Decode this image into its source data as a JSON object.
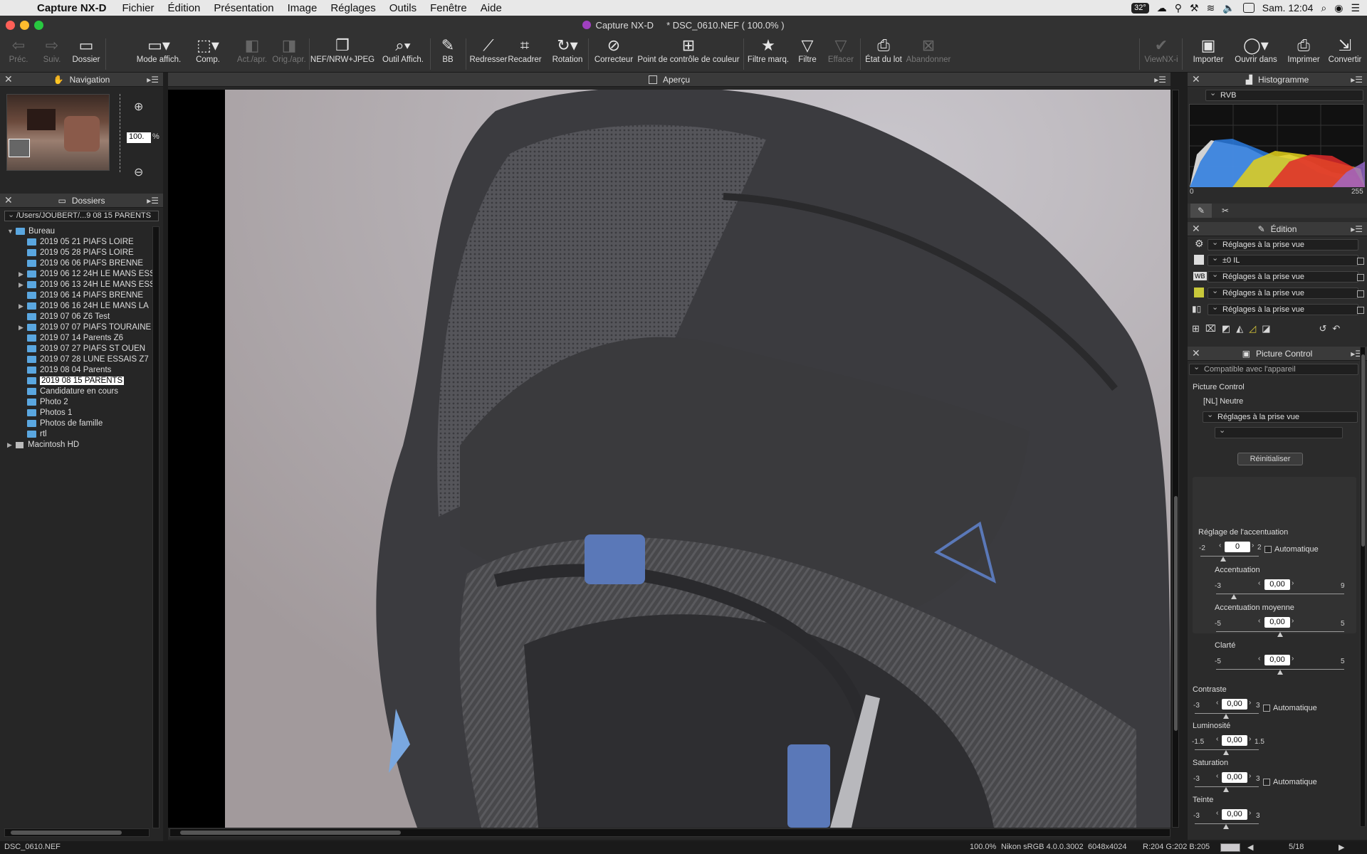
{
  "menubar": {
    "app": "Capture NX-D",
    "items": [
      "Fichier",
      "Édition",
      "Présentation",
      "Image",
      "Réglages",
      "Outils",
      "Fenêtre",
      "Aide"
    ],
    "temp": "32°",
    "clock": "Sam. 12:04"
  },
  "window": {
    "app_title": "Capture NX-D",
    "doc_title": "* DSC_0610.NEF ( 100.0% )"
  },
  "toolbar": {
    "prec": "Préc.",
    "suiv": "Suiv.",
    "dossier": "Dossier",
    "mode_affich": "Mode affich.",
    "comp": "Comp.",
    "act_apr": "Act./apr.",
    "orig_apr": "Orig./apr.",
    "nef": "NEF/NRW+JPEG",
    "outil_affich": "Outil Affich.",
    "bb": "BB",
    "redresser": "Redresser",
    "recadrer": "Recadrer",
    "rotation": "Rotation",
    "correcteur": "Correcteur",
    "point_controle": "Point de contrôle de couleur",
    "filtre_marq": "Filtre marq.",
    "filtre": "Filtre",
    "effacer": "Effacer",
    "etat_lot": "État du lot",
    "abandonner": "Abandonner",
    "viewnx": "ViewNX-i",
    "importer": "Importer",
    "ouvrir_dans": "Ouvrir dans",
    "imprimer": "Imprimer",
    "convertir": "Convertir"
  },
  "navigation": {
    "title": "Navigation",
    "zoom_value": "100.",
    "zoom_unit": "%"
  },
  "folders": {
    "title": "Dossiers",
    "path": "/Users/JOUBERT/...9 08 15 PARENTS",
    "root": "Bureau",
    "items": [
      "2019 05 21 PIAFS LOIRE",
      "2019 05 28 PIAFS LOIRE",
      "2019 06 06 PIAFS BRENNE",
      "2019 06 12 24H LE MANS ESS",
      "2019 06 13 24H LE MANS ESS",
      "2019 06 14 PIAFS BRENNE",
      "2019 06 16 24H LE MANS LA",
      "2019 07 06 Z6 Test",
      "2019 07 07 PIAFS TOURAINE",
      "2019 07 14 Parents Z6",
      "2019 07 27 PIAFS ST OUEN",
      "2019 07 28 LUNE ESSAIS Z7",
      "2019 08 04 Parents",
      "2019 08 15 PARENTS",
      "Candidature en cours",
      "Photo 2",
      "Photos 1",
      "Photos de famille",
      "rtl"
    ],
    "drive": "Macintosh HD"
  },
  "viewer": {
    "title": "Aperçu"
  },
  "histogram": {
    "title": "Histogramme",
    "channel": "RVB",
    "min": "0",
    "max": "255"
  },
  "edition": {
    "title": "Édition",
    "rows": [
      "Réglages à la prise vue",
      "±0 IL",
      "Réglages à la prise vue",
      "Réglages à la prise vue",
      "Réglages à la prise vue"
    ],
    "wb_badge": "WB"
  },
  "picture_control": {
    "title": "Picture Control",
    "compat": "Compatible avec l'appareil",
    "label": "Picture Control",
    "mode": "[NL] Neutre",
    "setting": "Réglages à la prise vue",
    "reset": "Réinitialiser",
    "sharp_adj": {
      "label": "Réglage de l'accentuation",
      "min": "-2",
      "max": "2",
      "value": "0",
      "auto": "Automatique"
    },
    "sharpening": {
      "label": "Accentuation",
      "min": "-3",
      "max": "9",
      "value": "0,00"
    },
    "mid_sharp": {
      "label": "Accentuation moyenne",
      "min": "-5",
      "max": "5",
      "value": "0,00"
    },
    "clarity": {
      "label": "Clarté",
      "min": "-5",
      "max": "5",
      "value": "0,00"
    },
    "contrast": {
      "label": "Contraste",
      "min": "-3",
      "max": "3",
      "value": "0,00",
      "auto": "Automatique"
    },
    "brightness": {
      "label": "Luminosité",
      "min": "-1.5",
      "max": "1.5",
      "value": "0,00"
    },
    "saturation": {
      "label": "Saturation",
      "min": "-3",
      "max": "3",
      "value": "0,00",
      "auto": "Automatique"
    },
    "hue": {
      "label": "Teinte",
      "min": "-3",
      "max": "3",
      "value": "0,00"
    }
  },
  "statusbar": {
    "file": "DSC_0610.NEF",
    "zoom": "100.0%",
    "profile": "Nikon sRGB 4.0.0.3002",
    "size": "6048x4024",
    "rgb": "R:204 G:202 B:205",
    "count": "5/18"
  }
}
